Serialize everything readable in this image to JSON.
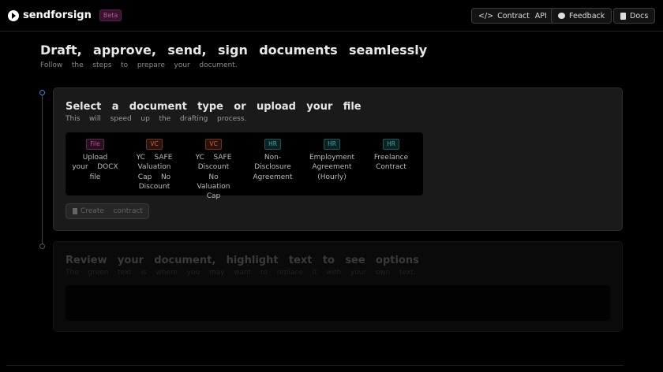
{
  "header": {
    "brand": "sendforsign",
    "beta": "Beta",
    "buttons": [
      {
        "label": "Contract API",
        "icon": "code-icon"
      },
      {
        "label": "Feedback",
        "icon": "chat-icon"
      },
      {
        "label": "Docs",
        "icon": "book-icon"
      }
    ]
  },
  "hero": {
    "title": "Draft, approve, send, sign documents seamlessly",
    "subtitle": "Follow the steps to prepare your document."
  },
  "step1": {
    "title": "Select a document type or upload your file",
    "subtitle": "This will speed up the drafting process.",
    "templates": [
      {
        "tag": "File",
        "label": "Upload your DOCX file",
        "color": "#c04a9a"
      },
      {
        "tag": "VC",
        "label": "YC SAFE Valuation Cap No Discount",
        "color": "#d0603a"
      },
      {
        "tag": "VC",
        "label": "YC SAFE Discount No Valuation Cap",
        "color": "#d0603a"
      },
      {
        "tag": "HR",
        "label": "Non-Disclosure Agreement",
        "color": "#3aa8a8"
      },
      {
        "tag": "HR",
        "label": "Employment Agreement (Hourly)",
        "color": "#3aa8a8"
      },
      {
        "tag": "HR",
        "label": "Freelance Contract",
        "color": "#3aa8a8"
      }
    ],
    "create_label": "Create contract"
  },
  "step2": {
    "title": "Review your document, highlight text to see options",
    "subtitle": "The green text is where you may want to replace it with your own text."
  }
}
